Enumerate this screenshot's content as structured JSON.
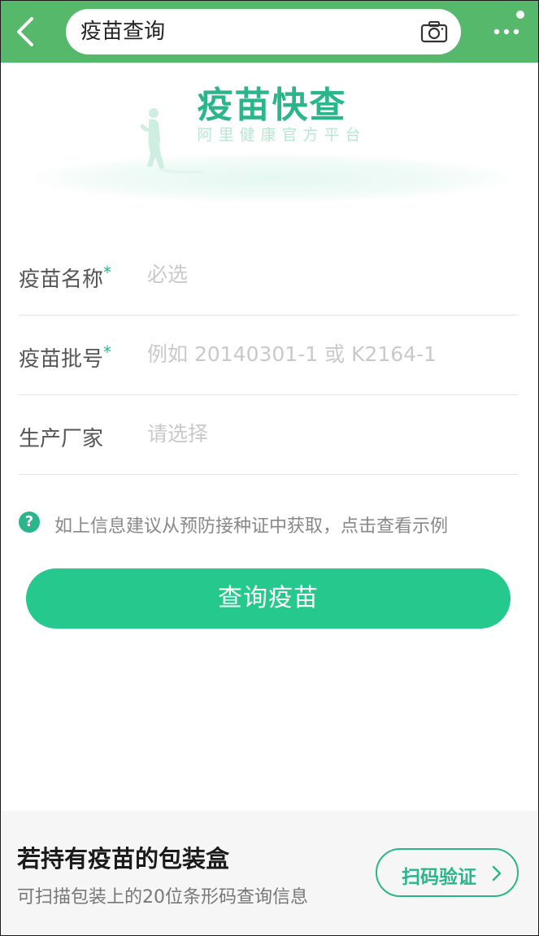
{
  "topbar": {
    "search_text": "疫苗查询",
    "back_icon": "chevron-left-icon",
    "camera_icon": "camera-icon",
    "more_icon": "more-dots-icon",
    "bar_color": "#56b86a"
  },
  "hero": {
    "title": "疫苗快查",
    "subtitle": "阿里健康官方平台"
  },
  "form": {
    "fields": [
      {
        "label": "疫苗名称",
        "required_mark": "*",
        "placeholder": "必选"
      },
      {
        "label": "疫苗批号",
        "required_mark": "*",
        "placeholder": "例如 20140301-1 或 K2164-1"
      },
      {
        "label": "生产厂家",
        "required_mark": "",
        "placeholder": "请选择"
      }
    ],
    "hint_icon_glyph": "?",
    "hint": "如上信息建议从预防接种证中获取，点击查看示例",
    "submit_label": "查询疫苗",
    "accent_color": "#25c98d"
  },
  "bottom": {
    "title": "若持有疫苗的包装盒",
    "subtitle": "可扫描包装上的20位条形码查询信息",
    "scan_label": "扫码验证"
  }
}
